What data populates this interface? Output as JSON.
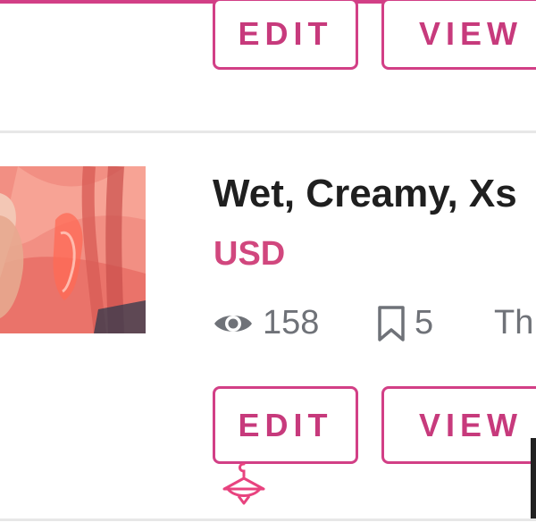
{
  "buttons": {
    "edit_label": "EDIT",
    "view_label": "VIEW"
  },
  "listing": {
    "title": "Wet, Creamy, Xs",
    "price": "USD",
    "views": "158",
    "saves": "5",
    "third_stat": "Th"
  },
  "colors": {
    "accent": "#d23f86",
    "price": "#d1477e",
    "muted": "#6f7278",
    "divider": "#e7e7e7"
  },
  "icons": [
    "eye-icon",
    "bookmark-icon",
    "hanger-icon"
  ]
}
